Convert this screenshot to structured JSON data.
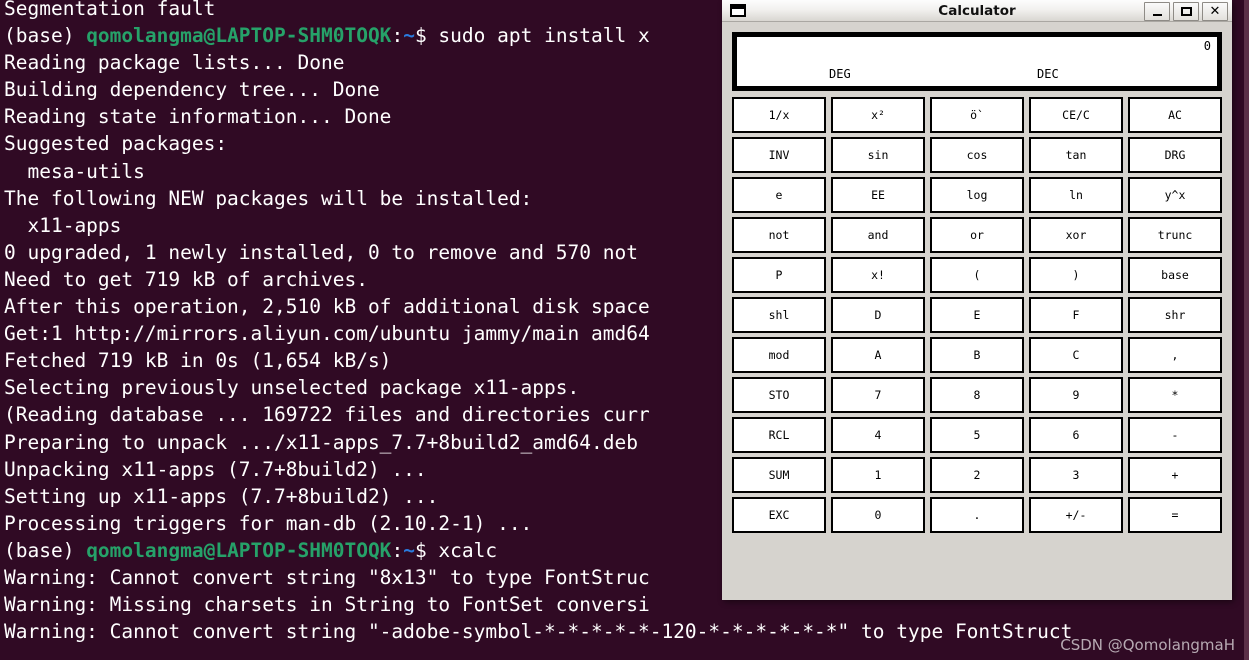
{
  "terminal": {
    "background_color": "#300a24",
    "text_color": "#ffffff",
    "prompt_user_color": "#26a269",
    "prompt_path_color": "#2a7bde",
    "prompt_env": "(base)",
    "prompt_user_host": "qomolangma@LAPTOP-SHM0TOQK",
    "prompt_path": ":~$",
    "lines": [
      {
        "type": "plain",
        "text": "Segmentation fault"
      },
      {
        "type": "prompt",
        "command": " sudo apt install x"
      },
      {
        "type": "plain",
        "text": "Reading package lists... Done"
      },
      {
        "type": "plain",
        "text": "Building dependency tree... Done"
      },
      {
        "type": "plain",
        "text": "Reading state information... Done"
      },
      {
        "type": "plain",
        "text": "Suggested packages:"
      },
      {
        "type": "plain",
        "text": "  mesa-utils"
      },
      {
        "type": "plain",
        "text": "The following NEW packages will be installed:"
      },
      {
        "type": "plain",
        "text": "  x11-apps"
      },
      {
        "type": "plain",
        "text": "0 upgraded, 1 newly installed, 0 to remove and 570 not"
      },
      {
        "type": "plain",
        "text": "Need to get 719 kB of archives."
      },
      {
        "type": "plain",
        "text": "After this operation, 2,510 kB of additional disk space"
      },
      {
        "type": "plain",
        "text": "Get:1 http://mirrors.aliyun.com/ubuntu jammy/main amd64"
      },
      {
        "type": "plain",
        "text": "Fetched 719 kB in 0s (1,654 kB/s)"
      },
      {
        "type": "plain",
        "text": "Selecting previously unselected package x11-apps."
      },
      {
        "type": "plain",
        "text": "(Reading database ... 169722 files and directories curr"
      },
      {
        "type": "plain",
        "text": "Preparing to unpack .../x11-apps_7.7+8build2_amd64.deb"
      },
      {
        "type": "plain",
        "text": "Unpacking x11-apps (7.7+8build2) ..."
      },
      {
        "type": "plain",
        "text": "Setting up x11-apps (7.7+8build2) ..."
      },
      {
        "type": "plain",
        "text": "Processing triggers for man-db (2.10.2-1) ..."
      },
      {
        "type": "prompt",
        "command": " xcalc"
      },
      {
        "type": "plain",
        "text": "Warning: Cannot convert string \"8x13\" to type FontStruc"
      },
      {
        "type": "plain",
        "text": "Warning: Missing charsets in String to FontSet conversi"
      },
      {
        "type": "plain",
        "text": "Warning: Cannot convert string \"-adobe-symbol-*-*-*-*-*-120-*-*-*-*-*-*\" to type FontStruct"
      }
    ]
  },
  "watermark": {
    "text": "CSDN @QomolangmaH"
  },
  "calculator": {
    "title": "Calculator",
    "app_icon": "window-icon",
    "window_buttons": [
      {
        "name": "minimize-button",
        "label": "–"
      },
      {
        "name": "maximize-button",
        "label": "▭"
      },
      {
        "name": "close-button",
        "label": "✕"
      }
    ],
    "display": {
      "value": "0",
      "angle_mode": "DEG",
      "base_mode": "DEC",
      "background_color": "#ffffff",
      "border_color": "#000000"
    },
    "keys": [
      "1/x",
      "x²",
      "ö`",
      "CE/C",
      "AC",
      "INV",
      "sin",
      "cos",
      "tan",
      "DRG",
      "e",
      "EE",
      "log",
      "ln",
      "y^x",
      "not",
      "and",
      "or",
      "xor",
      "trunc",
      "P",
      "x!",
      "(",
      ")",
      "base",
      "shl",
      "D",
      "E",
      "F",
      "shr",
      "mod",
      "A",
      "B",
      "C",
      ",",
      "STO",
      "7",
      "8",
      "9",
      "*",
      "RCL",
      "4",
      "5",
      "6",
      "-",
      "SUM",
      "1",
      "2",
      "3",
      "+",
      "EXC",
      "0",
      ".",
      "+/-",
      "="
    ]
  }
}
